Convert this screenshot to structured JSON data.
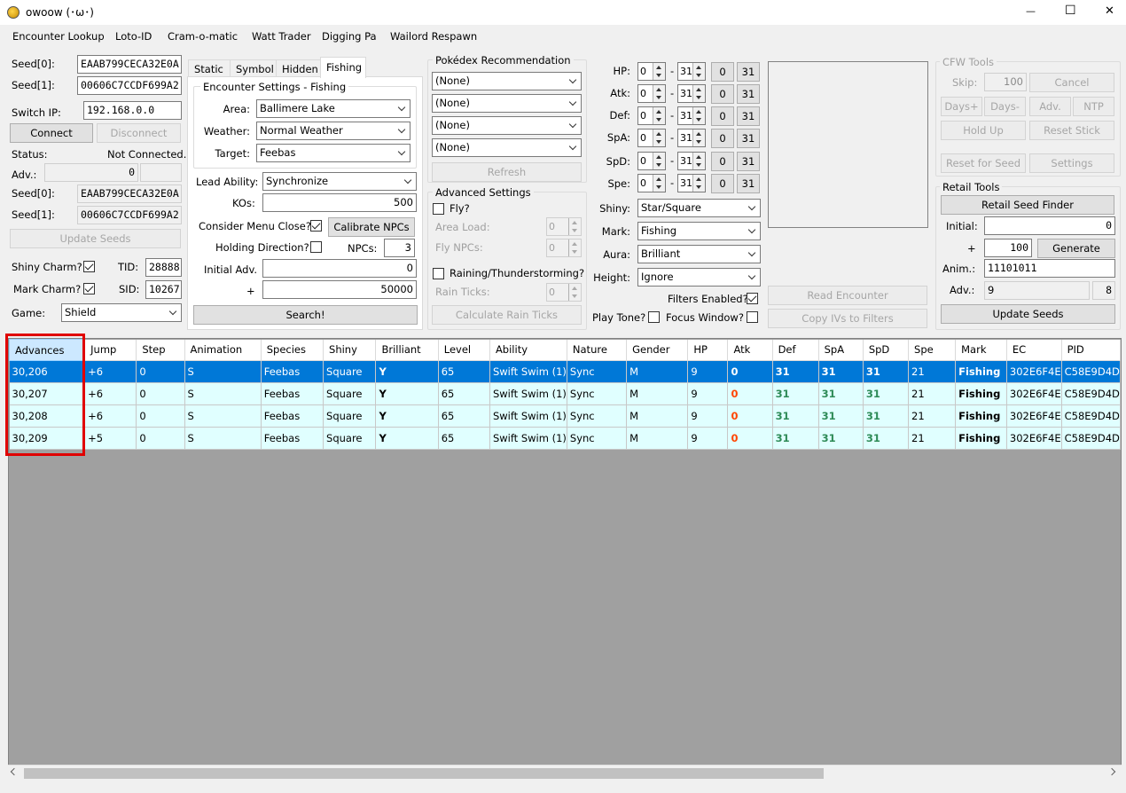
{
  "window": {
    "title": "owoow (･ω･)",
    "minimize": "—",
    "maximize": "☐",
    "close": "✕"
  },
  "menu": [
    "Encounter Lookup",
    "Loto-ID",
    "Cram-o-matic",
    "Watt Trader",
    "Digging Pa",
    "Wailord Respawn"
  ],
  "left": {
    "seed0_label": "Seed[0]:",
    "seed0": "EAAB799CECA32E0A",
    "seed1_label": "Seed[1]:",
    "seed1": "00606C7CCDF699A2",
    "switch_ip_label": "Switch IP:",
    "switch_ip": "192.168.0.0",
    "connect": "Connect",
    "disconnect": "Disconnect",
    "status_label": "Status:",
    "status": "Not Connected.",
    "adv_label": "Adv.:",
    "adv": "0",
    "seed0b_label": "Seed[0]:",
    "seed0b": "EAAB799CECA32E0A",
    "seed1b_label": "Seed[1]:",
    "seed1b": "00606C7CCDF699A2",
    "update_seeds": "Update Seeds",
    "shiny_charm_label": "Shiny Charm?",
    "tid_label": "TID:",
    "tid": "28888",
    "mark_charm_label": "Mark Charm?",
    "sid_label": "SID:",
    "sid": "10267",
    "game_label": "Game:",
    "game": "Shield"
  },
  "tabs": [
    "Static",
    "Symbol",
    "Hidden",
    "Fishing"
  ],
  "encounter": {
    "group_title": "Encounter Settings - Fishing",
    "area_label": "Area:",
    "area": "Ballimere Lake",
    "weather_label": "Weather:",
    "weather": "Normal Weather",
    "target_label": "Target:",
    "target": "Feebas",
    "lead_label": "Lead Ability:",
    "lead": "Synchronize",
    "kos_label": "KOs:",
    "kos": "500",
    "menu_close_label": "Consider Menu Close?",
    "calibrate": "Calibrate NPCs",
    "holding_label": "Holding Direction?",
    "npcs_label": "NPCs:",
    "npcs": "3",
    "initial_label": "Initial Adv.",
    "initial": "0",
    "plus_label": "+",
    "plus": "50000",
    "search": "Search!"
  },
  "pokedex": {
    "title": "Pokédex Recommendation",
    "options": [
      "(None)",
      "(None)",
      "(None)",
      "(None)"
    ],
    "refresh": "Refresh"
  },
  "advanced": {
    "title": "Advanced Settings",
    "fly_label": "Fly?",
    "area_load_label": "Area Load:",
    "area_load": "0",
    "fly_npcs_label": "Fly NPCs:",
    "fly_npcs": "0",
    "raining_label": "Raining/Thunderstorming?",
    "rain_ticks_label": "Rain Ticks:",
    "rain_ticks": "0",
    "calc_rain": "Calculate Rain Ticks"
  },
  "ivs": [
    {
      "label": "HP:",
      "min": "0",
      "max": "31",
      "b0": "0",
      "b31": "31"
    },
    {
      "label": "Atk:",
      "min": "0",
      "max": "31",
      "b0": "0",
      "b31": "31"
    },
    {
      "label": "Def:",
      "min": "0",
      "max": "31",
      "b0": "0",
      "b31": "31"
    },
    {
      "label": "SpA:",
      "min": "0",
      "max": "31",
      "b0": "0",
      "b31": "31"
    },
    {
      "label": "SpD:",
      "min": "0",
      "max": "31",
      "b0": "0",
      "b31": "31"
    },
    {
      "label": "Spe:",
      "min": "0",
      "max": "31",
      "b0": "0",
      "b31": "31"
    }
  ],
  "iv_dash": "-",
  "filters": {
    "shiny_label": "Shiny:",
    "shiny": "Star/Square",
    "mark_label": "Mark:",
    "mark": "Fishing",
    "aura_label": "Aura:",
    "aura": "Brilliant",
    "height_label": "Height:",
    "height": "Ignore",
    "filters_enabled_label": "Filters Enabled?",
    "play_tone_label": "Play Tone?",
    "focus_label": "Focus Window?"
  },
  "preview": {
    "read_encounter": "Read Encounter",
    "copy_ivs": "Copy IVs to Filters"
  },
  "cfw": {
    "title": "CFW Tools",
    "skip_label": "Skip:",
    "skip": "100",
    "cancel": "Cancel",
    "days_plus": "Days+",
    "days_minus": "Days-",
    "adv": "Adv.",
    "ntp": "NTP",
    "hold_up": "Hold Up",
    "reset_stick": "Reset Stick",
    "reset_seed": "Reset for Seed",
    "settings": "Settings"
  },
  "retail": {
    "title": "Retail Tools",
    "finder": "Retail Seed Finder",
    "initial_label": "Initial:",
    "initial": "0",
    "plus_label": "+",
    "plus": "100",
    "generate": "Generate",
    "anim_label": "Anim.:",
    "anim": "11101011",
    "adv_label": "Adv.:",
    "adv": "9",
    "adv2": "8",
    "update_seeds": "Update Seeds"
  },
  "table": {
    "columns": [
      "Advances",
      "Jump",
      "Step",
      "Animation",
      "Species",
      "Shiny",
      "Brilliant",
      "Level",
      "Ability",
      "Nature",
      "Gender",
      "HP",
      "Atk",
      "Def",
      "SpA",
      "SpD",
      "Spe",
      "Mark",
      "EC",
      "PID"
    ],
    "rows": [
      [
        "30,206",
        "+6",
        "0",
        "S",
        "Feebas",
        "Square",
        "Y",
        "65",
        "Swift Swim (1)",
        "Sync",
        "M",
        "9",
        "0",
        "31",
        "31",
        "31",
        "21",
        "Fishing",
        "302E6F4E",
        "C58E9D4D"
      ],
      [
        "30,207",
        "+6",
        "0",
        "S",
        "Feebas",
        "Square",
        "Y",
        "65",
        "Swift Swim (1)",
        "Sync",
        "M",
        "9",
        "0",
        "31",
        "31",
        "31",
        "21",
        "Fishing",
        "302E6F4E",
        "C58E9D4D"
      ],
      [
        "30,208",
        "+6",
        "0",
        "S",
        "Feebas",
        "Square",
        "Y",
        "65",
        "Swift Swim (1)",
        "Sync",
        "M",
        "9",
        "0",
        "31",
        "31",
        "31",
        "21",
        "Fishing",
        "302E6F4E",
        "C58E9D4D"
      ],
      [
        "30,209",
        "+5",
        "0",
        "S",
        "Feebas",
        "Square",
        "Y",
        "65",
        "Swift Swim (1)",
        "Sync",
        "M",
        "9",
        "0",
        "31",
        "31",
        "31",
        "21",
        "Fishing",
        "302E6F4E",
        "C58E9D4D"
      ]
    ]
  },
  "colors": {
    "selected_row": "#0078d7",
    "row_bg": "#e0ffff",
    "iv_zero": "#ff4500",
    "iv_max": "#2e8b57",
    "highlight_box": "#e00000"
  }
}
